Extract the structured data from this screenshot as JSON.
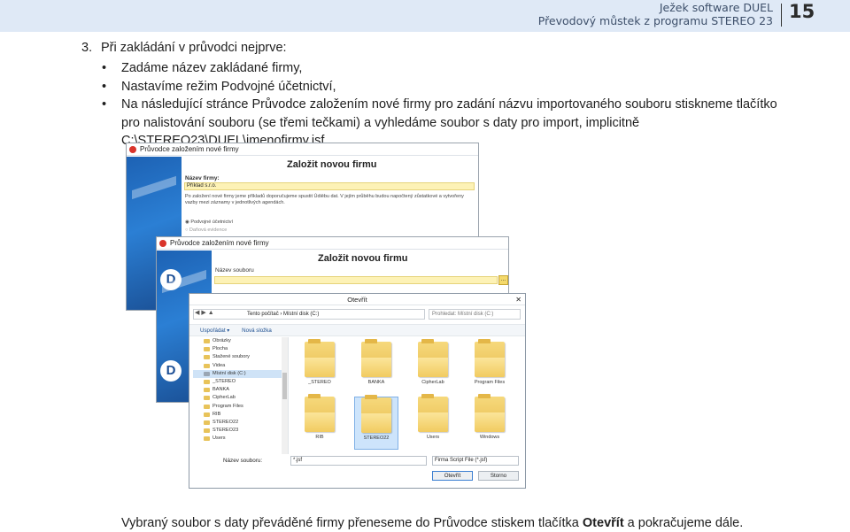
{
  "header": {
    "line1": "Ježek software DUEL",
    "line2": "Převodový můstek z programu STEREO 23",
    "page_number": "15"
  },
  "step": {
    "number": "3.",
    "title": "Při zakládání v průvodci nejprve:"
  },
  "bullets": [
    "Zadáme název zakládané firmy,",
    "Nastavíme režim Podvojné účetnictví,",
    "Na následující stránce Průvodce založením nové firmy pro zadání názvu importovaného souboru stiskneme tlačítko pro nalistování souboru (se třemi tečkami) a vyhledáme soubor s daty pro import, implicitně C:\\STEREO23\\DUEL\\jmenofirmy.jsf"
  ],
  "window1": {
    "title": "Průvodce založením nové firmy",
    "heading": "Založit novou firmu",
    "name_label": "Název firmy:",
    "name_value": "Příklad s.r.o.",
    "info_text": "Po založení nové firmy jeme příkladů doporučujeme spustit Údiěbu dat. V jejím průběhu budou napočtený zůstatkové a vytvořeny vazby mezi záznamy v jednotlivých agendách.",
    "option1": "Podvojné účetnictví",
    "option2": "Daňová evidence",
    "logo_letter": "D"
  },
  "window2": {
    "title": "Průvodce založením nové firmy",
    "heading": "Založit novou firmu",
    "file_label": "Název souboru",
    "browse_label": "...",
    "logo_letter": "D"
  },
  "dialog": {
    "title": "Otevřít",
    "close": "✕",
    "address": "Tento počítač › Místní disk (C:)",
    "search_placeholder": "Prohledat: Místní disk (C:)",
    "toolbar": [
      "Uspořádat ▾",
      "Nová složka"
    ],
    "tree": [
      {
        "label": "Obrázky",
        "selected": false,
        "drive": false
      },
      {
        "label": "Plocha",
        "selected": false,
        "drive": false
      },
      {
        "label": "Stažené soubory",
        "selected": false,
        "drive": false
      },
      {
        "label": "Videa",
        "selected": false,
        "drive": false
      },
      {
        "label": "Místní disk (C:)",
        "selected": true,
        "drive": true
      },
      {
        "label": "_STEREO",
        "selected": false,
        "drive": false
      },
      {
        "label": "BANKA",
        "selected": false,
        "drive": false
      },
      {
        "label": "CipherLab",
        "selected": false,
        "drive": false
      },
      {
        "label": "Program Files",
        "selected": false,
        "drive": false
      },
      {
        "label": "RIB",
        "selected": false,
        "drive": false
      },
      {
        "label": "STEREO22",
        "selected": false,
        "drive": false
      },
      {
        "label": "STEREO23",
        "selected": false,
        "drive": false
      },
      {
        "label": "Users",
        "selected": false,
        "drive": false
      }
    ],
    "folders": [
      "_STEREO",
      "BANKA",
      "CipherLab",
      "Program Files",
      "RIB",
      "STEREO22",
      "Users",
      "Windows"
    ],
    "highlighted_folder": "STEREO22",
    "filename_label": "Název souboru:",
    "filename_value": "*.jsf",
    "filetype_value": "Firma Script File (*.jsf)",
    "open_button": "Otevřít",
    "cancel_button": "Storno"
  },
  "caption": {
    "before": "Vybraný soubor s daty převáděné firmy přeneseme do Průvodce stiskem tlačítka ",
    "bold": "Otevřít",
    "after": " a pokračujeme dále."
  },
  "colors": {
    "header_bg": "#dfe9f6",
    "wizard_blue": "#2b7fd4",
    "field_yellow": "#fdf2b6",
    "folder_yellow": "#e9bd4f"
  }
}
